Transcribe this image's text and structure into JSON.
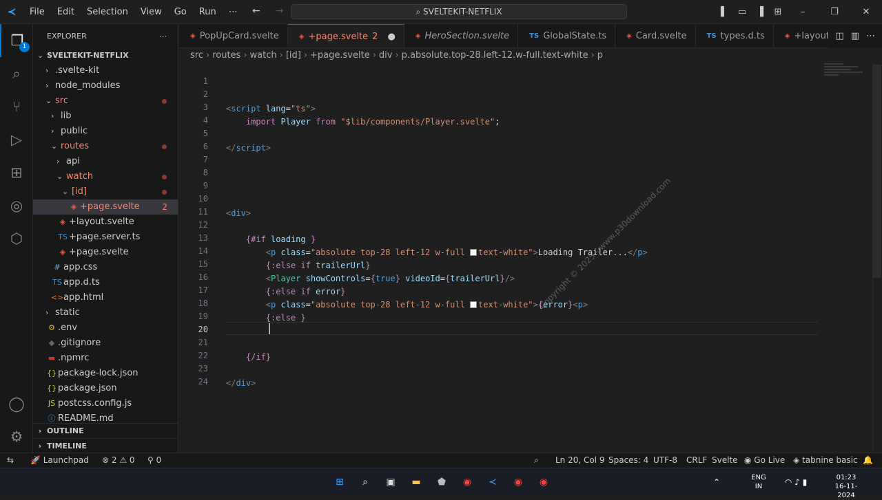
{
  "window": {
    "title": "SVELTEKIT-NETFLIX",
    "menu": [
      "File",
      "Edit",
      "Selection",
      "View",
      "Go",
      "Run",
      "⋯"
    ]
  },
  "activity_bar": {
    "explorer_badge": "1"
  },
  "sidebar": {
    "header": "EXPLORER",
    "tree": [
      {
        "label": "SVELTEKIT-NETFLIX",
        "depth": 0,
        "type": "root"
      },
      {
        "label": ".svelte-kit",
        "depth": 1,
        "type": "folder",
        "open": false
      },
      {
        "label": "node_modules",
        "depth": 1,
        "type": "folder",
        "open": false
      },
      {
        "label": "src",
        "depth": 1,
        "type": "folder",
        "open": true,
        "modified": true
      },
      {
        "label": "lib",
        "depth": 2,
        "type": "folder",
        "open": false
      },
      {
        "label": "public",
        "depth": 2,
        "type": "folder",
        "open": false
      },
      {
        "label": "routes",
        "depth": 2,
        "type": "folder",
        "open": true,
        "modified": true
      },
      {
        "label": "api",
        "depth": 3,
        "type": "folder",
        "open": false
      },
      {
        "label": "watch",
        "depth": 3,
        "type": "folder",
        "open": true,
        "modified": true
      },
      {
        "label": "[id]",
        "depth": 4,
        "type": "folder",
        "open": true,
        "modified": true
      },
      {
        "label": "+page.svelte",
        "depth": 5,
        "type": "svelte",
        "count": "2",
        "selected": true
      },
      {
        "label": "+layout.svelte",
        "depth": 3,
        "type": "svelte"
      },
      {
        "label": "+page.server.ts",
        "depth": 3,
        "type": "ts"
      },
      {
        "label": "+page.svelte",
        "depth": 3,
        "type": "svelte"
      },
      {
        "label": "app.css",
        "depth": 2,
        "type": "css"
      },
      {
        "label": "app.d.ts",
        "depth": 2,
        "type": "ts"
      },
      {
        "label": "app.html",
        "depth": 2,
        "type": "html"
      },
      {
        "label": "static",
        "depth": 1,
        "type": "folder",
        "open": false
      },
      {
        "label": ".env",
        "depth": 1,
        "type": "env"
      },
      {
        "label": ".gitignore",
        "depth": 1,
        "type": "git"
      },
      {
        "label": ".npmrc",
        "depth": 1,
        "type": "npm"
      },
      {
        "label": "package-lock.json",
        "depth": 1,
        "type": "json"
      },
      {
        "label": "package.json",
        "depth": 1,
        "type": "json"
      },
      {
        "label": "postcss.config.js",
        "depth": 1,
        "type": "js"
      },
      {
        "label": "README.md",
        "depth": 1,
        "type": "md"
      }
    ],
    "sections": [
      "OUTLINE",
      "TIMELINE"
    ]
  },
  "tabs": [
    {
      "label": "PopUpCard.svelte",
      "type": "svelte"
    },
    {
      "label": "+page.svelte",
      "type": "svelte",
      "active": true,
      "count": "2",
      "dirty": true
    },
    {
      "label": "HeroSection.svelte",
      "type": "svelte"
    },
    {
      "label": "GlobalState.ts",
      "type": "ts"
    },
    {
      "label": "Card.svelte",
      "type": "svelte"
    },
    {
      "label": "types.d.ts",
      "type": "ts"
    },
    {
      "label": "+layout.",
      "type": "svelte"
    }
  ],
  "breadcrumb": [
    "src",
    "routes",
    "watch",
    "[id]",
    "+page.svelte",
    "div",
    "p.absolute.top-28.left-12.w-full.text-white",
    "p"
  ],
  "code": {
    "line_numbers": [
      "1",
      "2",
      "3",
      "4",
      "5",
      "6",
      "7",
      "8",
      "9",
      "10",
      "11",
      "12",
      "13",
      "14",
      "15",
      "16",
      "17",
      "18",
      "19",
      "20",
      "21",
      "22",
      "23",
      "24"
    ],
    "current_line": "20"
  },
  "watermark": "Copyright © 2025 - www.p30download.com",
  "status": {
    "launchpad": "Launchpad",
    "errors": "2",
    "warnings": "0",
    "ports": "0",
    "position": "Ln 20, Col 9",
    "spaces": "Spaces: 4",
    "encoding": "UTF-8",
    "eol": "CRLF",
    "language": "Svelte",
    "golive": "Go Live",
    "tabnine": "tabnine basic"
  },
  "taskbar": {
    "lang": "ENG",
    "region": "IN",
    "time": "01:23",
    "date": "16-11-2024"
  }
}
